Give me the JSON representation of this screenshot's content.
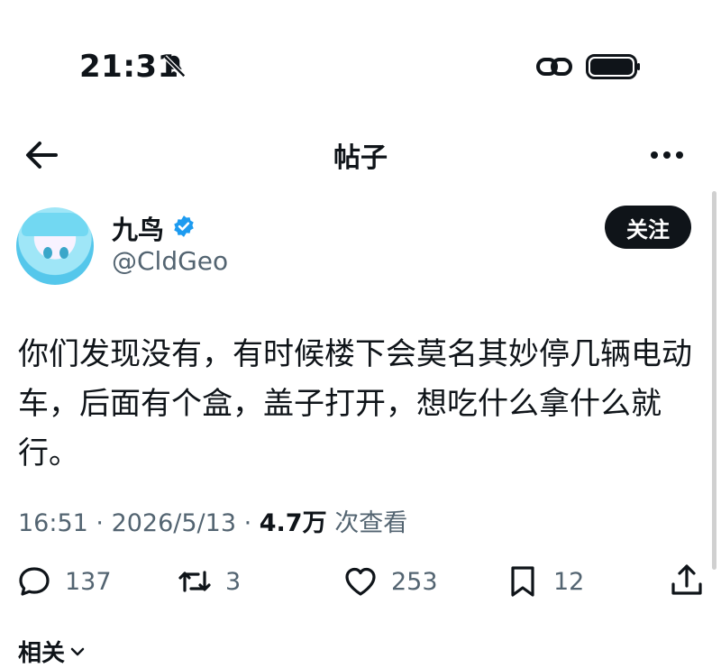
{
  "status_bar": {
    "time": "21:31"
  },
  "nav": {
    "title": "帖子"
  },
  "author": {
    "name": "九鸟",
    "handle": "@CldGeo",
    "follow_label": "关注"
  },
  "post": {
    "text": "你们发现没有，有时候楼下会莫名其妙停几辆电动车，后面有个盒，盖子打开，想吃什么拿什么就行。",
    "time": "16:51",
    "sep": " · ",
    "date": "2026/5/13",
    "views": "4.7万",
    "views_label": " 次查看"
  },
  "actions": {
    "replies": "137",
    "retweets": "3",
    "likes": "253",
    "bookmarks": "12"
  },
  "related_label": "相关",
  "icons": [
    "bell-slash-icon",
    "link-icon",
    "battery-icon",
    "back-arrow-icon",
    "more-icon",
    "verified-icon",
    "reply-icon",
    "retweet-icon",
    "like-icon",
    "bookmark-icon",
    "share-icon",
    "chevron-down-icon"
  ],
  "colors": {
    "verified": "#1d9bf0",
    "muted": "#536471",
    "text": "#0f1419"
  }
}
